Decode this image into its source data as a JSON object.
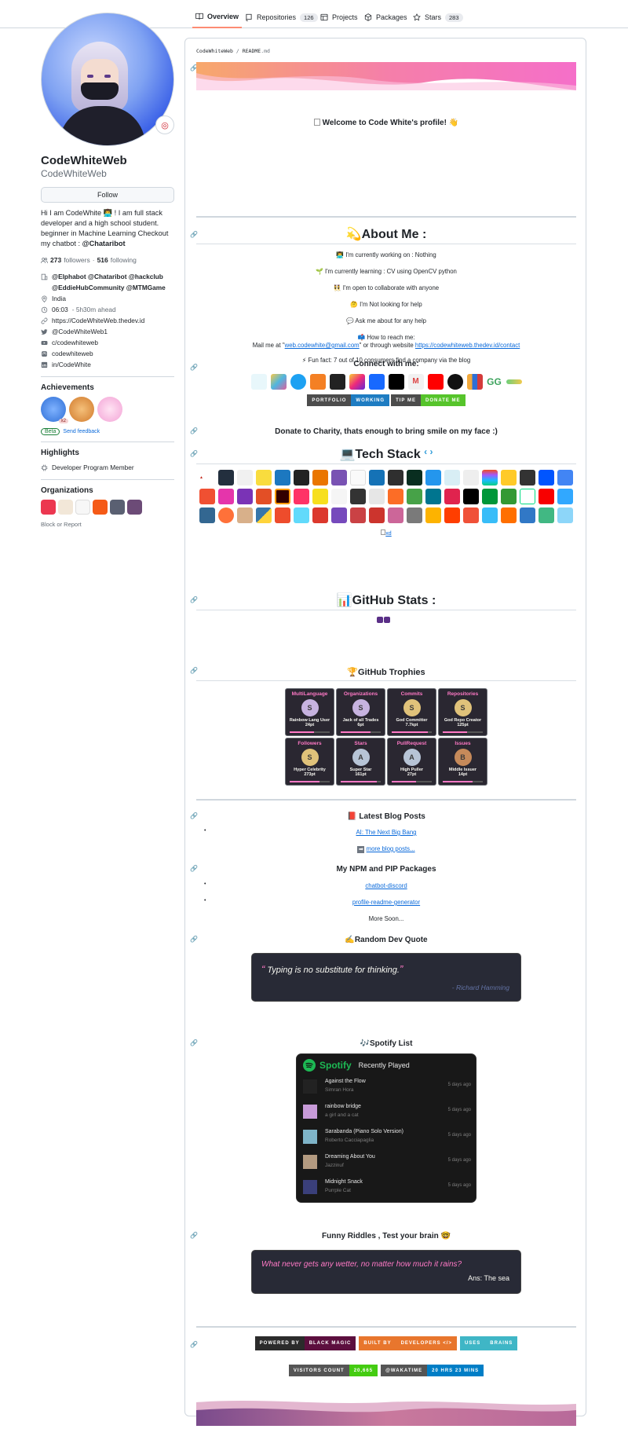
{
  "tabs": [
    {
      "label": "Overview",
      "count": "",
      "icon": "book-icon",
      "active": true
    },
    {
      "label": "Repositories",
      "count": "126",
      "icon": "repo-icon",
      "active": false
    },
    {
      "label": "Projects",
      "count": "",
      "icon": "table-icon",
      "active": false
    },
    {
      "label": "Packages",
      "count": "",
      "icon": "package-icon",
      "active": false
    },
    {
      "label": "Stars",
      "count": "283",
      "icon": "star-icon",
      "active": false
    }
  ],
  "profile": {
    "name": "CodeWhiteWeb",
    "login": "CodeWhiteWeb",
    "follow_label": "Follow",
    "bio_1": "Hi I am CodeWhite 👨‍💻 ! I am full stack developer and a high school student. beginner in Machine Learning Checkout my chatbot : ",
    "bio_handle": "@Chataribot",
    "followers": "273",
    "followers_label": "followers",
    "following": "516",
    "following_label": "following",
    "organizations_line": "@Elphabot @Chataribot @hackclub @EddieHubCommunity @MTMGame",
    "location": "India",
    "time": "06:03",
    "time_note": "- 5h30m ahead",
    "website": "https://CodeWhiteWeb.thedev.id",
    "twitter": "@CodeWhiteWeb1",
    "youtube": "c/codewhiteweb",
    "mastodon": "codewhiteweb",
    "linkedin": "in/CodeWhite"
  },
  "achievements": {
    "heading": "Achievements",
    "x2": "x2",
    "beta": "Beta",
    "feedback": "Send feedback"
  },
  "highlights": {
    "heading": "Highlights",
    "item": "Developer Program Member"
  },
  "organizations": {
    "heading": "Organizations",
    "block": "Block or Report"
  },
  "readme": {
    "crumb_user": "CodeWhiteWeb",
    "crumb_sep": " / ",
    "crumb_file": "README",
    "crumb_ext": ".md",
    "welcome": "Welcome to Code White's profile!",
    "welcome_emoji": "👋",
    "about_heading": "💫About Me :",
    "about_lines": [
      "👨‍💻 I'm currently working on : Nothing",
      "🌱 I'm currently learning : CV using OpenCV python",
      "👯 I'm open to collaborate with anyone",
      "🤔 I'm Not looking for help",
      "💬 Ask me about for any help",
      "📫 How to reach me:"
    ],
    "mail_prefix": "Mail me at \"",
    "mail": "web.codewhite@gmail.com",
    "mail_mid": "\" or through website ",
    "mail_site": "https://codewhiteweb.thedev.id/contact",
    "fun_fact": "⚡ Fun fact: 7 out of 10 consumers find a company via the blog",
    "connect_heading": "Connect with me:",
    "portfolio_left": "PORTFOLIO",
    "portfolio_right": "WORKING",
    "tip_left": "TIP ME",
    "tip_right": "DONATE ME",
    "donate_text": "Donate to Charity, thats enough to bring smile on my face :)",
    "tech_heading": "💻Tech Stack",
    "xd_alt": "xd",
    "stats_heading": "📊GitHub Stats :",
    "trophies_heading": "🏆GitHub Trophies",
    "blog_heading": "📕 Latest Blog Posts",
    "blog_post": "AI: The Next Big Bang",
    "blog_more": "more blog posts...",
    "packages_heading": "My NPM and PIP Packages",
    "packages": [
      "chatbot-discord",
      "profile-readme-generator"
    ],
    "packages_more": "More Soon...",
    "quote_heading": "✍️Random Dev Quote",
    "quote_text": "Typing is no substitute for thinking.",
    "quote_author": "- Richard Hamming",
    "spotify_heading": "🎶Spotify List",
    "spotify_brand": "Spotify",
    "spotify_title": "Recently Played",
    "riddle_heading": "Funny Riddles , Test your brain 🤓",
    "riddle_q": "What never gets any wetter, no matter how much it rains?",
    "riddle_a": "Ans: The sea",
    "footer_badges": [
      {
        "left": "POWERED BY",
        "right": "BLACK MAGIC",
        "lc": "#2b2b2b",
        "rc": "#5c0f3e"
      },
      {
        "left": "BUILT BY",
        "right": "DEVELOPERS </>",
        "lc": "#e8762d",
        "rc": "#e8762d"
      },
      {
        "left": "USES",
        "right": "BRAINS",
        "lc": "#3fb6c6",
        "rc": "#3fb6c6"
      }
    ],
    "visitors_label": "VISITORS COUNT",
    "visitors_value": "20,665",
    "wakatime_label": "@WAKATIME",
    "wakatime_value": "20 HRS 23 MINS"
  },
  "trophies": [
    {
      "title": "MultiLanguage",
      "rank": "S",
      "name": "Rainbow Lang User",
      "pts": "24pt",
      "color": "#c7b3e0"
    },
    {
      "title": "Organizations",
      "rank": "S",
      "name": "Jack of all Trades",
      "pts": "6pt",
      "color": "#c7b3e0"
    },
    {
      "title": "Commits",
      "rank": "S",
      "name": "God Committer",
      "pts": "7.7kpt",
      "color": "#e0c27a"
    },
    {
      "title": "Repositories",
      "rank": "S",
      "name": "God Repo Creator",
      "pts": "125pt",
      "color": "#e0c27a"
    },
    {
      "title": "Followers",
      "rank": "S",
      "name": "Hyper Celebrity",
      "pts": "273pt",
      "color": "#e0c27a"
    },
    {
      "title": "Stars",
      "rank": "A",
      "name": "Super Star",
      "pts": "161pt",
      "color": "#b7c4d6"
    },
    {
      "title": "PullRequest",
      "rank": "A",
      "name": "High Puller",
      "pts": "27pt",
      "color": "#b7c4d6"
    },
    {
      "title": "Issues",
      "rank": "B",
      "name": "Middle Issuer",
      "pts": "14pt",
      "color": "#c68a5a"
    }
  ],
  "spotify_tracks": [
    {
      "title": "Against the Flow",
      "artist": "Simran Hora",
      "ago": "5 days ago",
      "art": "#222222"
    },
    {
      "title": "rainbow bridge",
      "artist": "a girl and a cat",
      "ago": "5 days ago",
      "art": "#c79ad8"
    },
    {
      "title": "Sarabanda (Piano Solo Version)",
      "artist": "Roberto Cacciapaglia",
      "ago": "5 days ago",
      "art": "#7fb4c8"
    },
    {
      "title": "Dreaming About You",
      "artist": "Jazzinuf",
      "ago": "5 days ago",
      "art": "#b39a80"
    },
    {
      "title": "Midnight Snack",
      "artist": "Purrple Cat",
      "ago": "5 days ago",
      "art": "#3a3f7a"
    }
  ]
}
